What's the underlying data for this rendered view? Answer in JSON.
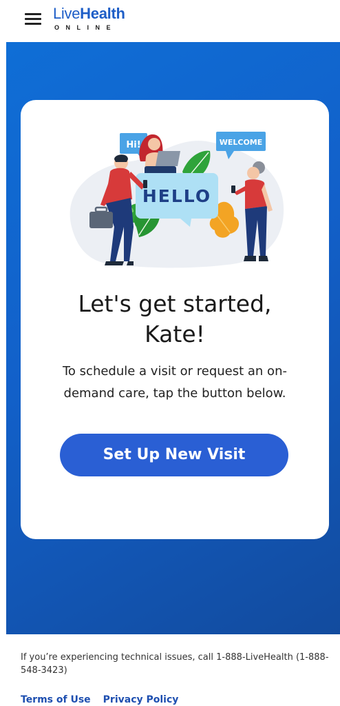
{
  "header": {
    "menu_icon": "hamburger-menu-icon",
    "logo_part1": "Live",
    "logo_part2": "Health",
    "logo_sub": "ONLINE"
  },
  "illustration": {
    "bubble_hi": "Hi!",
    "bubble_welcome": "WELCOME",
    "bubble_hello": "HELLO"
  },
  "card": {
    "title_line1": "Let's get started,",
    "title_line2": "Kate!",
    "description": "To schedule a visit or request an on-demand care, tap the button below.",
    "cta_label": "Set Up New Visit"
  },
  "footer": {
    "note": "If you’re experiencing technical issues, call 1-888-LiveHealth (1-888-548-3423)",
    "links": [
      "Terms of Use",
      "Privacy Policy"
    ]
  },
  "colors": {
    "brand_blue": "#1e5ec7",
    "hero_gradient_start": "#0f6ed6",
    "hero_gradient_end": "#124b9e",
    "cta_background": "#2a5fd4",
    "link_color": "#1e4fb0"
  }
}
